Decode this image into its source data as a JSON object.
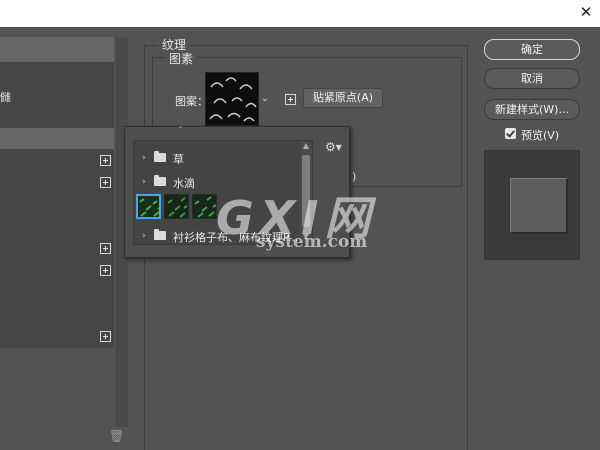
{
  "window": {
    "close_icon": "close-icon"
  },
  "left_panel": {
    "selected_label_fragment": "雠",
    "rows": [
      {
        "style": "light",
        "label": "",
        "has_plus": false
      },
      {
        "style": "dark",
        "label": "雠",
        "has_plus": false
      },
      {
        "style": "dark",
        "label": "",
        "has_plus": false
      },
      {
        "style": "light",
        "label": "",
        "has_plus": false
      },
      {
        "style": "dark",
        "label": "",
        "has_plus": true
      },
      {
        "style": "dark",
        "label": "",
        "has_plus": true
      },
      {
        "style": "dark",
        "label": "",
        "has_plus": false
      },
      {
        "style": "dark",
        "label": "",
        "has_plus": false
      },
      {
        "style": "dark",
        "label": "",
        "has_plus": true
      },
      {
        "style": "dark",
        "label": "",
        "has_plus": true
      },
      {
        "style": "dark",
        "label": "",
        "has_plus": false
      },
      {
        "style": "dark",
        "label": "",
        "has_plus": false
      },
      {
        "style": "dark",
        "label": "",
        "has_plus": true
      }
    ],
    "delete_icon": "trash-icon"
  },
  "texture": {
    "group_title": "纹理",
    "pattern_group_title": "图素",
    "pattern_label": "图案：",
    "pattern_dropdown_icon": "chevron-down-icon",
    "new_preset_icon": "plus-icon",
    "snap_origin_button": "贴紧原点(A)",
    "hidden_text": ")"
  },
  "pattern_picker": {
    "gear_icon": "gear-icon",
    "items": [
      {
        "type": "folder",
        "label": "草",
        "expanded": false
      },
      {
        "type": "folder",
        "label": "水滴",
        "expanded": false
      },
      {
        "type": "thumbnails",
        "count": 3,
        "selected_index": 0
      },
      {
        "type": "folder",
        "label": "衬衫格子布、麻布纹理P...",
        "expanded": false
      }
    ]
  },
  "buttons": {
    "ok": "确定",
    "cancel": "取消",
    "new_style": "新建样式(W)...",
    "preview_label": "预览(V)",
    "preview_checked": true
  },
  "watermark": {
    "big": "GXI网",
    "small": "system.com"
  }
}
